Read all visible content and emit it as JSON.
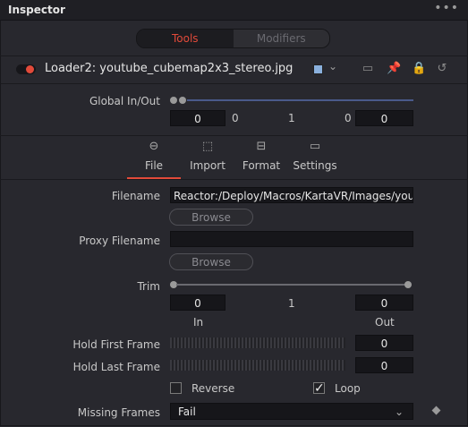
{
  "header": {
    "title": "Inspector",
    "menu_icon": "more-icon"
  },
  "mode_tabs": {
    "tools": "Tools",
    "modifiers": "Modifiers",
    "active": "Tools",
    "active_color": "#e24a3a"
  },
  "node": {
    "name": "Loader2: youtube_cubemap2x3_stereo.jpg",
    "swatch_color": "#8ab0dd"
  },
  "global_inout": {
    "label": "Global In/Out",
    "start": "0",
    "start_text": "0",
    "middle": "1",
    "end_text": "0",
    "end": "0"
  },
  "tabs": [
    {
      "label": "File",
      "icon": "file-icon"
    },
    {
      "label": "Import",
      "icon": "import-icon"
    },
    {
      "label": "Format",
      "icon": "format-icon"
    },
    {
      "label": "Settings",
      "icon": "settings-icon"
    }
  ],
  "active_tab": "File",
  "file": {
    "filename_label": "Filename",
    "filename_value": "Reactor:/Deploy/Macros/KartaVR/Images/youtub",
    "browse": "Browse",
    "proxy_label": "Proxy Filename",
    "proxy_value": "",
    "proxy_browse": "Browse",
    "trim_label": "Trim",
    "trim_in": "0",
    "trim_mid": "1",
    "trim_out": "0",
    "in_label": "In",
    "out_label": "Out",
    "hold_first_label": "Hold First Frame",
    "hold_first_value": "0",
    "hold_last_label": "Hold Last Frame",
    "hold_last_value": "0",
    "reverse_label": "Reverse",
    "reverse_checked": false,
    "loop_label": "Loop",
    "loop_checked": true,
    "missing_label": "Missing Frames",
    "missing_value": "Fail"
  }
}
